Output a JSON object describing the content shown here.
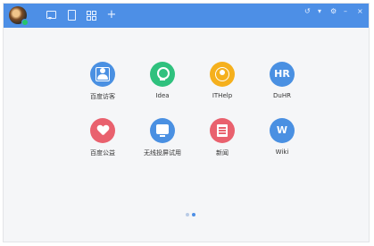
{
  "toolbar": {
    "icons": [
      "chat-icon",
      "document-icon",
      "grid-icon",
      "plus-icon"
    ],
    "plus_label": "+",
    "window_controls": [
      "↺",
      "▾",
      "⚙",
      "–",
      "×"
    ]
  },
  "colors": {
    "titlebar": "#4d8fe6",
    "background": "#f5f6f8",
    "online": "#27c46b"
  },
  "apps": [
    {
      "label": "百度访客",
      "color": "#4a90e2",
      "icon": "visitor-icon"
    },
    {
      "label": "Idea",
      "color": "#2fc17e",
      "icon": "idea-icon"
    },
    {
      "label": "ITHelp",
      "color": "#f5b01d",
      "icon": "ithelp-icon"
    },
    {
      "label": "DuHR",
      "color": "#4a90e2",
      "icon": "duhr-icon",
      "glyph": "HR"
    },
    {
      "label": "百度公益",
      "color": "#e9616e",
      "icon": "charity-icon"
    },
    {
      "label": "无线投屏试用",
      "color": "#4a90e2",
      "icon": "screencast-icon"
    },
    {
      "label": "新闻",
      "color": "#e9616e",
      "icon": "news-icon"
    },
    {
      "label": "Wiki",
      "color": "#4a90e2",
      "icon": "wiki-icon",
      "glyph": "W"
    }
  ],
  "pagination": {
    "pages": 2,
    "current": 2
  }
}
